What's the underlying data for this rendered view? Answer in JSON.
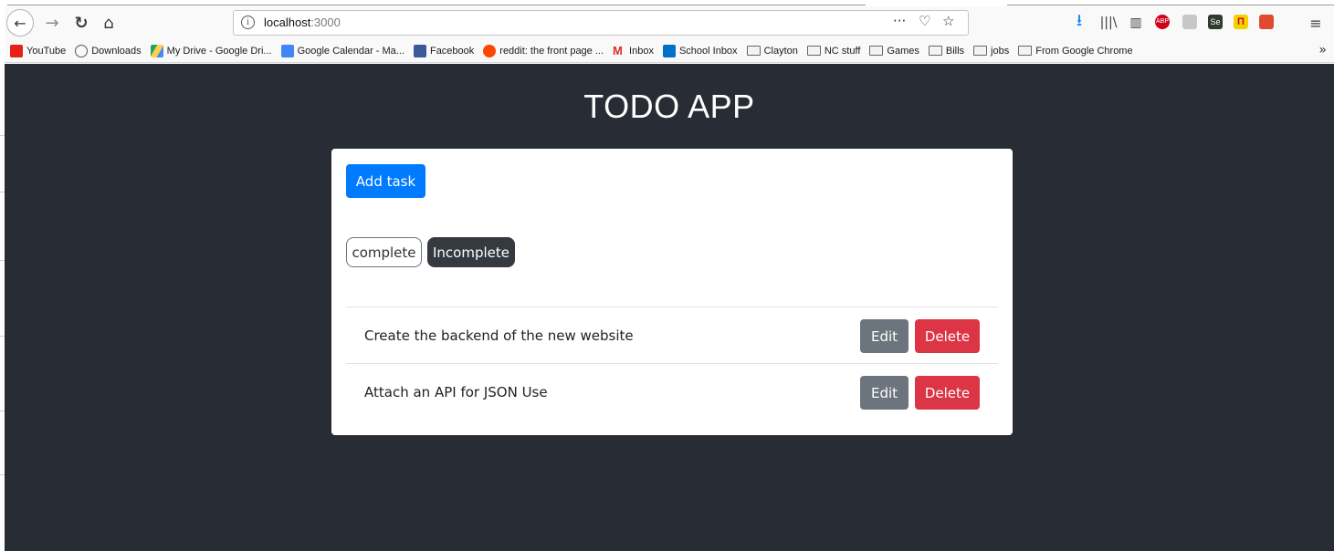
{
  "browser": {
    "url_host": "localhost",
    "url_port": ":3000",
    "icons": {
      "back": "arrow-left-icon",
      "forward": "arrow-right-icon",
      "reload": "reload-icon",
      "home": "home-icon",
      "info": "info-icon",
      "more": "ellipsis-icon",
      "pocket": "pocket-icon",
      "star": "star-icon",
      "download": "download-icon",
      "library": "library-icon",
      "sidebar": "sidebar-icon",
      "menu": "hamburger-icon"
    },
    "extension_labels": {
      "abp": "ABP",
      "se": "Se"
    }
  },
  "bookmarks": [
    {
      "label": "YouTube",
      "type": "site",
      "color": "#e62117"
    },
    {
      "label": "Downloads",
      "type": "site",
      "color": "#555555"
    },
    {
      "label": "My Drive - Google Dri...",
      "type": "site",
      "color": "#1fa463"
    },
    {
      "label": "Google Calendar - Ma...",
      "type": "site",
      "color": "#4285f4"
    },
    {
      "label": "Facebook",
      "type": "site",
      "color": "#3b5998"
    },
    {
      "label": "reddit: the front page ...",
      "type": "site",
      "color": "#ff4500"
    },
    {
      "label": "Inbox",
      "type": "site",
      "color": "#d93025"
    },
    {
      "label": "School Inbox",
      "type": "site",
      "color": "#0072c6"
    },
    {
      "label": "Clayton",
      "type": "folder"
    },
    {
      "label": "NC stuff",
      "type": "folder"
    },
    {
      "label": "Games",
      "type": "folder"
    },
    {
      "label": "Bills",
      "type": "folder"
    },
    {
      "label": "jobs",
      "type": "folder"
    },
    {
      "label": "From Google Chrome",
      "type": "folder"
    }
  ],
  "bookmarks_overflow": "»",
  "app": {
    "title": "TODO APP",
    "add_button": "Add task",
    "filters": {
      "complete": "complete",
      "incomplete": "Incomplete"
    },
    "tasks": [
      {
        "label": "Create the backend of the new website",
        "edit": "Edit",
        "delete": "Delete"
      },
      {
        "label": "Attach an API for JSON Use",
        "edit": "Edit",
        "delete": "Delete"
      }
    ]
  },
  "colors": {
    "primary": "#007bff",
    "danger": "#dc3545",
    "secondary": "#6c757d",
    "dark": "#343a40",
    "background": "#282c34"
  }
}
